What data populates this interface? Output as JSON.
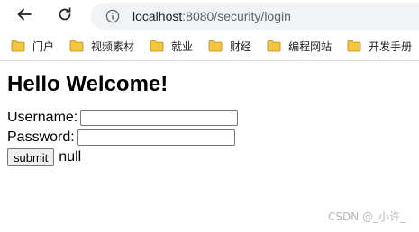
{
  "browser": {
    "url_host": "localhost",
    "url_path": ":8080/security/login",
    "bookmarks": [
      {
        "label": "门户"
      },
      {
        "label": "视频素材"
      },
      {
        "label": "就业"
      },
      {
        "label": "财经"
      },
      {
        "label": "编程网站"
      },
      {
        "label": "开发手册"
      }
    ],
    "colors": {
      "address_bg": "#f1f3f4",
      "folder": "#f4c542",
      "icon": "#5f6368"
    }
  },
  "page": {
    "heading": "Hello Welcome!",
    "username_label": "Username:",
    "username_value": "",
    "password_label": "Password:",
    "password_value": "",
    "submit_label": "submit",
    "message": "null"
  },
  "watermark": "CSDN @_小许_"
}
